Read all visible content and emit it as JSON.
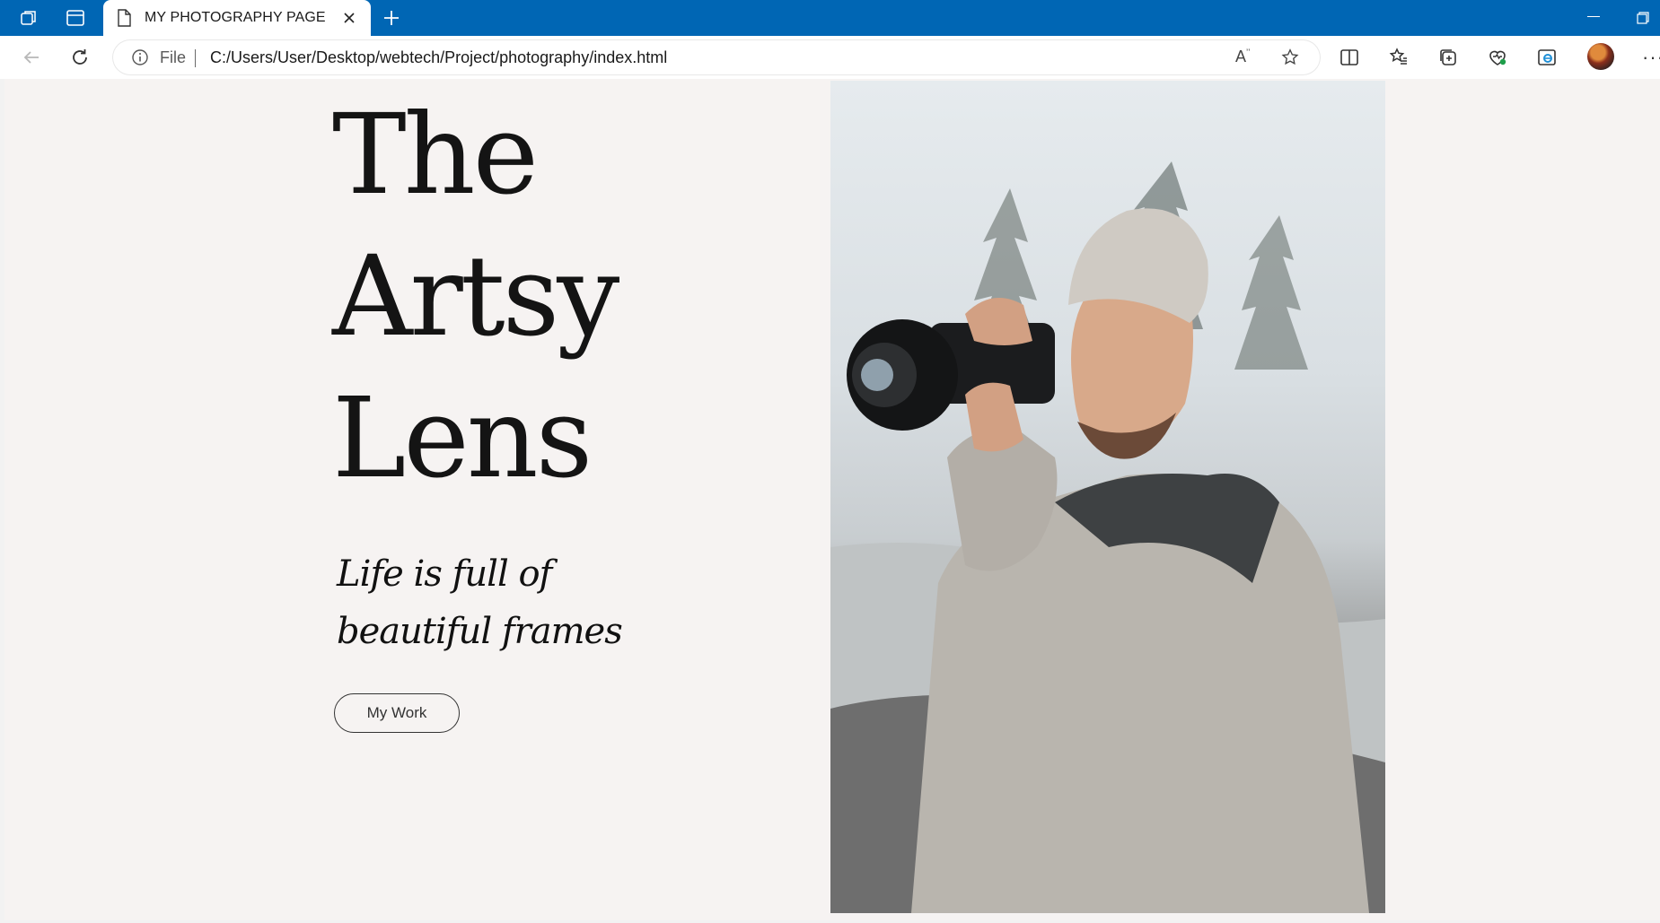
{
  "browser": {
    "tab_title": "MY PHOTOGRAPHY PAGE",
    "address": {
      "scheme_label": "File",
      "url": "C:/Users/User/Desktop/webtech/Project/photography/index.html"
    },
    "accent_color": "#0066b4"
  },
  "page": {
    "title_lines": [
      "The",
      "Artsy",
      "Lens"
    ],
    "tagline": "Life is full of beautiful frames",
    "cta_label": "My Work",
    "background_color": "#f6f3f2",
    "hero_image": "photographer-with-camera"
  }
}
